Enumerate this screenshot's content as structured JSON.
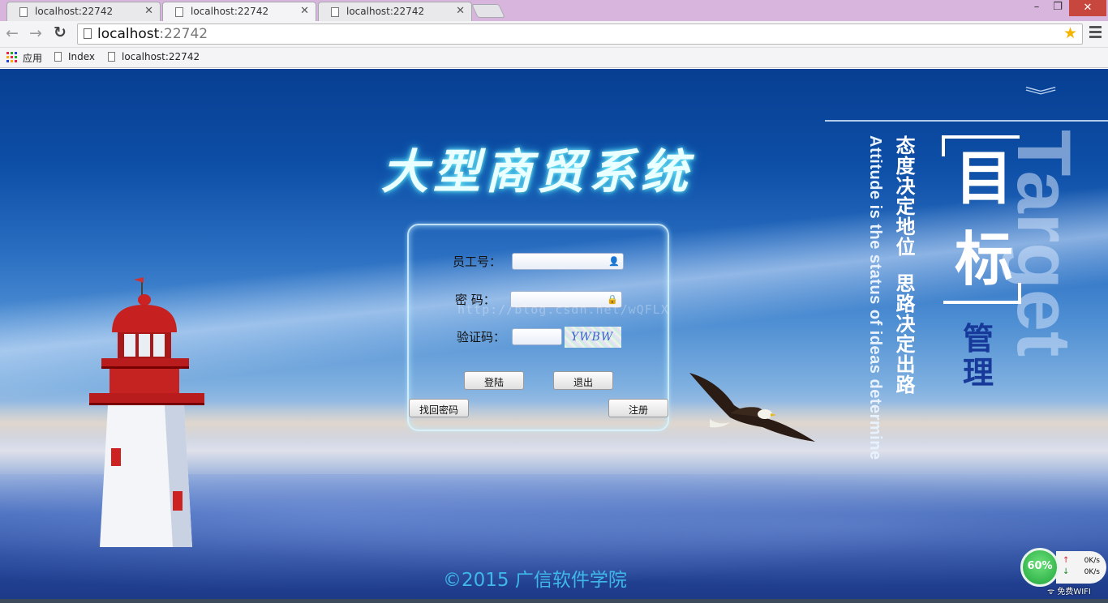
{
  "browser": {
    "tabs": [
      {
        "title": "localhost:22742",
        "active": false
      },
      {
        "title": "localhost:22742",
        "active": true
      },
      {
        "title": "localhost:22742",
        "active": false
      }
    ],
    "address": {
      "host": "localhost",
      "port": ":22742"
    },
    "bookmarks": {
      "apps": "应用",
      "items": [
        "Index",
        "localhost:22742"
      ]
    },
    "window_controls": {
      "minimize": "–",
      "maximize": "❐",
      "close": "✕"
    }
  },
  "page": {
    "title": "大型商贸系统",
    "login": {
      "employee_label": "员工号：",
      "password_label": "密 码：",
      "captcha_label": "验证码：",
      "captcha_text": "YWBW",
      "login_button": "登陆",
      "exit_button": "退出",
      "recover_button": "找回密码",
      "register_button": "注册"
    },
    "watermark": "http://blog.csdn.net/wQFLX",
    "slogan": {
      "en": "Attitude is the status of ideas determine",
      "cn_line1": "态度决定地位",
      "cn_line2": "思路决定出路",
      "big_word": "Target",
      "big_char": "目标",
      "manage": "管理"
    },
    "footer": "©2015 广信软件学院"
  },
  "net_widget": {
    "percent": "60%",
    "upload": "0K/s",
    "download": "0K/s",
    "wifi_label": "免费WIFI"
  },
  "colors": {
    "title_glow": "#39c7f0",
    "footer": "#3fb7e8",
    "manage": "#17399a",
    "close_btn": "#c7463d"
  }
}
